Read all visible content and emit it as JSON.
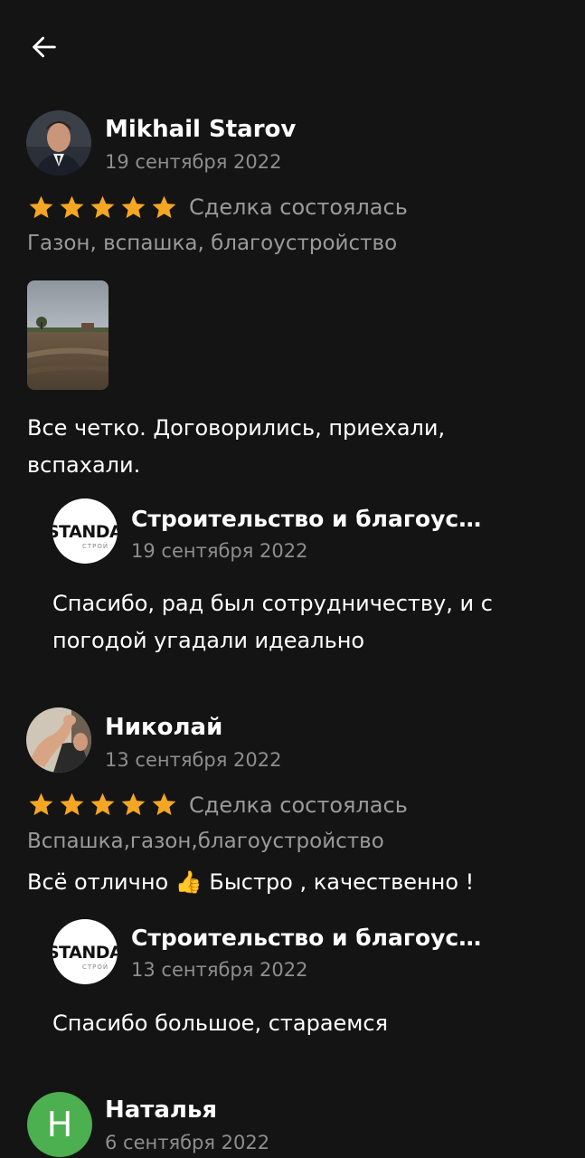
{
  "colors": {
    "background": "#141414",
    "star": "#f5a623",
    "muted_text": "#8e8e8e",
    "avatar_green": "#4caf50"
  },
  "header": {
    "back_icon": "arrow-left-icon"
  },
  "reviews": [
    {
      "author": "Mikhail Starov",
      "date": "19 сентября 2022",
      "rating": 5,
      "deal_status": "Сделка состоялась",
      "tags": "Газон, вспашка, благоустройство",
      "text": "Все четко. Договорились, приехали, вспахали.",
      "reply": {
        "author": "Строительство и благоустройство",
        "logo_text": "STANDARD",
        "logo_sub": "СТРОЙ",
        "date": "19 сентября 2022",
        "text": "Спасибо, рад был сотрудничеству, и с погодой угадали идеально"
      }
    },
    {
      "author": "Николай",
      "date": "13 сентября 2022",
      "rating": 5,
      "deal_status": "Сделка состоялась",
      "tags": "Вспашка,газон,благоустройство",
      "text": "Всё отлично 👍 Быстро , качественно  !",
      "reply": {
        "author": "Строительство и благоустройство",
        "logo_text": "STANDARD",
        "logo_sub": "СТРОЙ",
        "date": "13 сентября 2022",
        "text": "Спасибо большое, стараемся"
      }
    },
    {
      "author": "Наталья",
      "avatar_letter": "Н",
      "date": "6 сентября 2022"
    }
  ]
}
